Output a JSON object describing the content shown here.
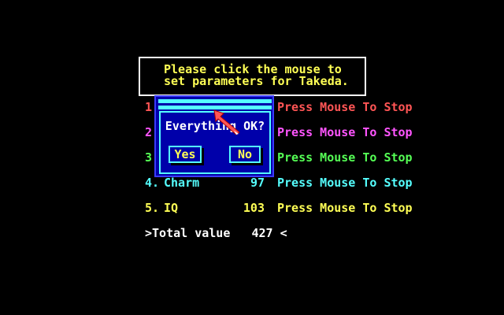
{
  "header": {
    "line1": "Please click the mouse to",
    "line2": "set parameters for Takeda."
  },
  "rows": [
    {
      "num": "1.",
      "name": "",
      "value": "",
      "press": "Press Mouse To Stop",
      "color": "#ff5555"
    },
    {
      "num": "2.",
      "name": "",
      "value": "",
      "press": "Press Mouse To Stop",
      "color": "#ff55ff"
    },
    {
      "num": "3.",
      "name": "",
      "value": "",
      "press": "Press Mouse To Stop",
      "color": "#55ff55"
    },
    {
      "num": "4.",
      "name": "Charm",
      "value": "97",
      "press": "Press Mouse To Stop",
      "color": "#55ffff"
    },
    {
      "num": "5.",
      "name": "IQ",
      "value": "103",
      "press": "Press Mouse To Stop",
      "color": "#ffff55"
    }
  ],
  "total": {
    "label": ">Total value",
    "value": "427",
    "suffix": "<"
  },
  "dialog": {
    "question": "Everything OK?",
    "yes": "Yes",
    "no": "No"
  },
  "colors": {
    "background": "#000000",
    "dialog_bg": "#0000aa",
    "dialog_accent": "#55ffff",
    "header_text": "#ffff55"
  },
  "icons": {
    "cursor": "arrow-pointer-icon"
  }
}
